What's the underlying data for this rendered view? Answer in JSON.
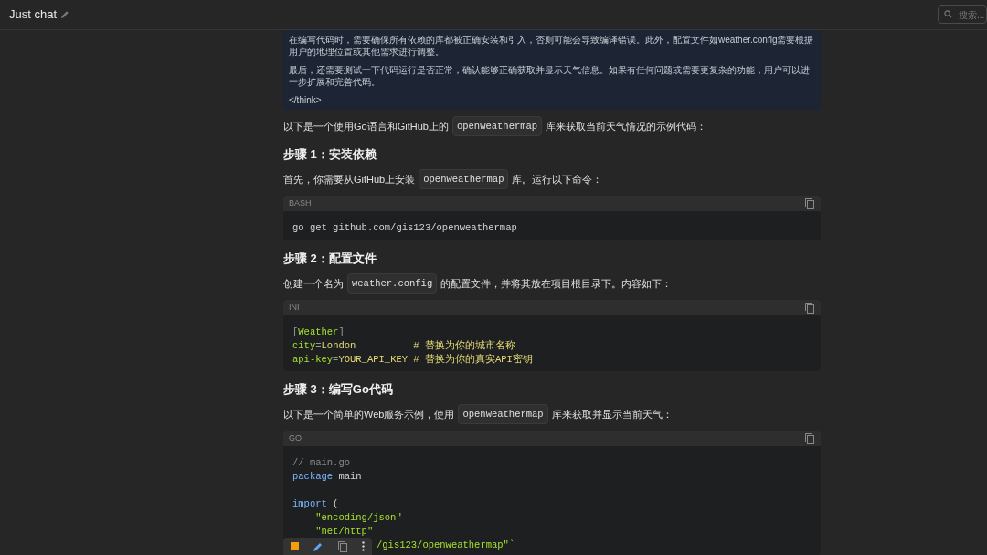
{
  "header": {
    "title": "Just chat",
    "search": {
      "placeholder": "搜索..."
    }
  },
  "think": {
    "paragraphs": [
      "在编写代码时，需要确保所有依赖的库都被正确安装和引入，否则可能会导致编译错误。此外，配置文件如weather.config需要根据用户的地理位置或其他需求进行调整。",
      "最后，还需要测试一下代码运行是否正常，确认能够正确获取并显示天气信息。如果有任何问题或需要更复杂的功能，用户可以进一步扩展和完善代码。"
    ],
    "end_tag": "</think>"
  },
  "blocks": [
    {
      "kind": "paragraph",
      "parts": [
        {
          "kind": "text",
          "text": "以下是一个使用Go语言和GitHub上的"
        },
        {
          "kind": "code",
          "text": "openweathermap"
        },
        {
          "kind": "text",
          "text": "库来获取当前天气情况的示例代码："
        }
      ]
    },
    {
      "kind": "heading",
      "text": "步骤 1：安装依赖"
    },
    {
      "kind": "paragraph",
      "parts": [
        {
          "kind": "text",
          "text": "首先，你需要从GitHub上安装"
        },
        {
          "kind": "code",
          "text": "openweathermap"
        },
        {
          "kind": "text",
          "text": "库。运行以下命令："
        }
      ]
    },
    {
      "kind": "codeblock",
      "language": "BASH",
      "lines": [
        {
          "kind": "code",
          "tokens": [
            {
              "kind": "plain",
              "text": "go get github.com/gis123/openweathermap"
            }
          ]
        }
      ]
    },
    {
      "kind": "heading",
      "text": "步骤 2：配置文件"
    },
    {
      "kind": "paragraph",
      "parts": [
        {
          "kind": "text",
          "text": "创建一个名为"
        },
        {
          "kind": "code",
          "text": "weather.config"
        },
        {
          "kind": "text",
          "text": "的配置文件，并将其放在项目根目录下。内容如下："
        }
      ]
    },
    {
      "kind": "codeblock",
      "language": "INI",
      "lines": [
        {
          "kind": "code",
          "tokens": [
            {
              "kind": "punct",
              "text": "["
            },
            {
              "kind": "key",
              "text": "Weather"
            },
            {
              "kind": "punct",
              "text": "]"
            }
          ]
        },
        {
          "kind": "code",
          "tokens": [
            {
              "kind": "key",
              "text": "city"
            },
            {
              "kind": "punct",
              "text": "="
            },
            {
              "kind": "value",
              "text": "London          # 替换为你的城市名称"
            }
          ]
        },
        {
          "kind": "code",
          "tokens": [
            {
              "kind": "key",
              "text": "api-key"
            },
            {
              "kind": "punct",
              "text": "="
            },
            {
              "kind": "value",
              "text": "YOUR_API_KEY # 替换为你的真实API密钥"
            }
          ]
        }
      ]
    },
    {
      "kind": "heading",
      "text": "步骤 3：编写Go代码"
    },
    {
      "kind": "paragraph",
      "parts": [
        {
          "kind": "text",
          "text": "以下是一个简单的Web服务示例，使用"
        },
        {
          "kind": "code",
          "text": "openweathermap"
        },
        {
          "kind": "text",
          "text": "库来获取并显示当前天气："
        }
      ]
    },
    {
      "kind": "codeblock",
      "language": "GO",
      "lines": [
        {
          "kind": "code",
          "tokens": [
            {
              "kind": "comment",
              "text": "// main.go"
            }
          ]
        },
        {
          "kind": "code",
          "tokens": [
            {
              "kind": "keyword",
              "text": "package"
            },
            {
              "kind": "plain",
              "text": " main"
            }
          ]
        },
        {
          "kind": "blank"
        },
        {
          "kind": "code",
          "tokens": [
            {
              "kind": "keyword",
              "text": "import"
            },
            {
              "kind": "plain",
              "text": " ("
            }
          ]
        },
        {
          "kind": "code",
          "tokens": [
            {
              "kind": "string",
              "text": "    \"encoding/json\""
            }
          ]
        },
        {
          "kind": "code",
          "tokens": [
            {
              "kind": "string",
              "text": "    \"net/http\""
            }
          ]
        },
        {
          "kind": "continued",
          "tokens": [
            {
              "kind": "string",
              "text": "/gis123/openweathermap\"`"
            }
          ]
        }
      ]
    }
  ]
}
